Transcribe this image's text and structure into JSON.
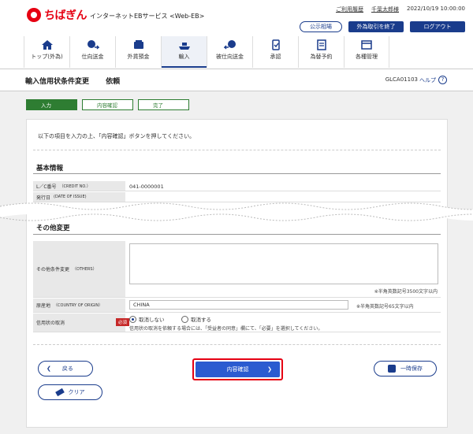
{
  "brand": {
    "logo_text": "ちばぎん",
    "service": "インターネットEBサービス <Web-EB>"
  },
  "top_links": {
    "usage_history": "ご利用履歴",
    "user": "千葉太郎様",
    "datetime": "2022/10/19 10:00:00"
  },
  "top_buttons": {
    "public_rates": "公示相場",
    "end_fx": "外為取引を終了",
    "logout": "ログアウト"
  },
  "nav": [
    {
      "label": "トップ(外為)",
      "icon": "home-icon"
    },
    {
      "label": "仕向送金",
      "icon": "remit-icon"
    },
    {
      "label": "外貨預金",
      "icon": "deposit-icon"
    },
    {
      "label": "輸入",
      "icon": "ship-icon"
    },
    {
      "label": "被仕向送金",
      "icon": "receive-icon"
    },
    {
      "label": "承認",
      "icon": "approve-icon"
    },
    {
      "label": "為替予約",
      "icon": "exchange-icon"
    },
    {
      "label": "各種管理",
      "icon": "manage-icon"
    }
  ],
  "page": {
    "title": "輸入信用状条件変更",
    "subtitle": "依頼",
    "screen_id": "GLCA01103",
    "help": "ヘルプ"
  },
  "steps": [
    "入力",
    "内容確認",
    "完了"
  ],
  "instruction": "以下の項目を入力の上、「内容確認」ボタンを押してください。",
  "basic": {
    "title": "基本情報",
    "rows": [
      {
        "label": "L／C番号",
        "sub": "（CREDIT NO.）",
        "value": "041-0000001"
      },
      {
        "label": "発行日",
        "sub": "(DATE OF ISSUE)",
        "value": ""
      }
    ]
  },
  "other": {
    "title": "その他変更",
    "others_label": "その他条件変更",
    "others_sub": "（OTHERS）",
    "others_note": "※半角英数記号3500文字以内",
    "origin_label": "原産地",
    "origin_sub": "（COUNTRY OF ORIGIN）",
    "origin_value": "CHINA",
    "origin_note": "※半角英数記号65文字以内",
    "cancel_label": "信用状の取消",
    "required": "必須",
    "radio_no": "取消しない",
    "radio_yes": "取消する",
    "cancel_note": "信用状の取消を依頼する場合には、「受益者の同意」欄にて、「必要」を選択してください。"
  },
  "buttons": {
    "back": "戻る",
    "confirm": "内容確認",
    "save": "一時保存",
    "clear": "クリア"
  },
  "colors": {
    "brand": "#e60012",
    "navy": "#1a3c8c",
    "step_green": "#2e7d32",
    "primary": "#2b5bd0"
  }
}
